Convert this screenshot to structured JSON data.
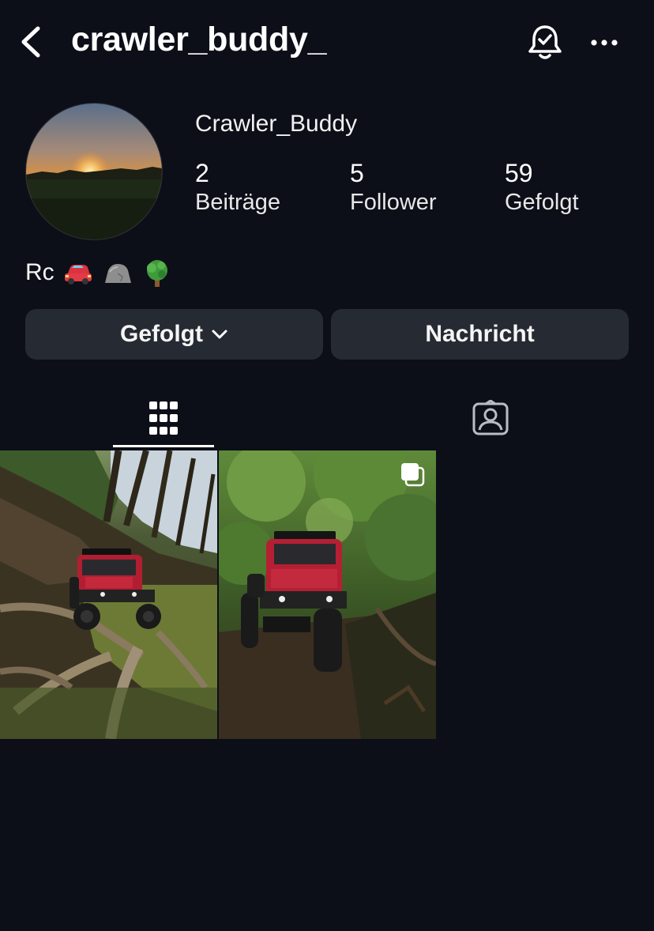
{
  "header": {
    "username": "crawler_buddy_",
    "icons": {
      "back": "chevron-left-icon",
      "notifications": "bell-check-icon",
      "more": "more-horizontal-icon"
    }
  },
  "profile": {
    "display_name": "Crawler_Buddy",
    "stats": [
      {
        "value": "2",
        "label": "Beiträge"
      },
      {
        "value": "5",
        "label": "Follower"
      },
      {
        "value": "59",
        "label": "Gefolgt"
      }
    ],
    "bio_text": "Rc",
    "bio_emojis": [
      "car-emoji",
      "rock-emoji",
      "tree-emoji"
    ]
  },
  "actions": {
    "follow_label": "Gefolgt",
    "message_label": "Nachricht"
  },
  "tabs": [
    {
      "name": "posts-grid",
      "icon": "grid-icon",
      "active": true
    },
    {
      "name": "tagged",
      "icon": "tagged-person-icon",
      "active": false
    }
  ],
  "posts": [
    {
      "type": "photo",
      "multiple": false
    },
    {
      "type": "photo",
      "multiple": true
    }
  ],
  "colors": {
    "background": "#0c0f18",
    "button": "#262a33",
    "text": "#ffffff",
    "car_red": "#c0283a"
  }
}
